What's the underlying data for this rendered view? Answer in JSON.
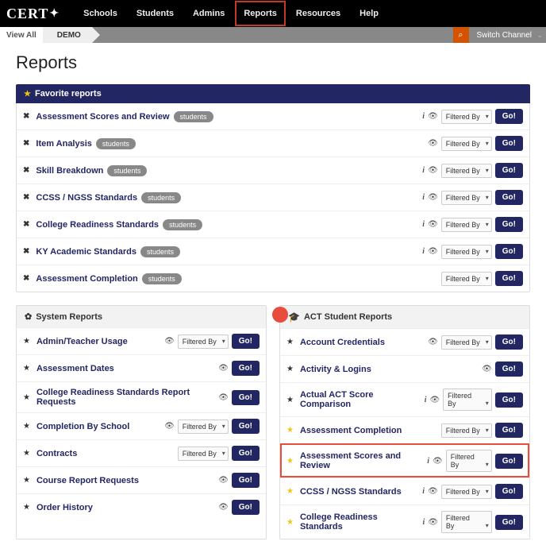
{
  "brand": "CERT",
  "nav": {
    "items": [
      "Schools",
      "Students",
      "Admins",
      "Reports",
      "Resources",
      "Help"
    ],
    "active": "Reports"
  },
  "subbar": {
    "viewAll": "View All",
    "demo": "DEMO",
    "switch": "Switch Channel"
  },
  "page": {
    "title": "Reports"
  },
  "labels": {
    "filteredBy": "Filtered By",
    "go": "Go!",
    "favoriteReports": "Favorite reports"
  },
  "favorites": [
    {
      "name": "Assessment Scores and Review",
      "badge": "students",
      "info": true,
      "eye": true
    },
    {
      "name": "Item Analysis",
      "badge": "students",
      "info": false,
      "eye": true
    },
    {
      "name": "Skill Breakdown",
      "badge": "students",
      "info": true,
      "eye": true
    },
    {
      "name": "CCSS / NGSS Standards",
      "badge": "students",
      "info": true,
      "eye": true
    },
    {
      "name": "College Readiness Standards",
      "badge": "students",
      "info": true,
      "eye": true
    },
    {
      "name": "KY Academic Standards",
      "badge": "students",
      "info": true,
      "eye": true
    },
    {
      "name": "Assessment Completion",
      "badge": "students",
      "info": false,
      "eye": false
    }
  ],
  "systemReports": {
    "title": "System Reports",
    "items": [
      {
        "name": "Admin/Teacher Usage",
        "eye": true,
        "filter": true
      },
      {
        "name": "Assessment Dates",
        "eye": true,
        "filter": false
      },
      {
        "name": "College Readiness Standards Report Requests",
        "eye": true,
        "filter": false
      },
      {
        "name": "Completion By School",
        "eye": true,
        "filter": true
      },
      {
        "name": "Contracts",
        "eye": false,
        "filter": true
      },
      {
        "name": "Course Report Requests",
        "eye": true,
        "filter": false
      },
      {
        "name": "Order History",
        "eye": true,
        "filter": false
      }
    ]
  },
  "actReports": {
    "title": "ACT Student Reports",
    "items": [
      {
        "name": "Account Credentials",
        "fav": false,
        "eye": true,
        "info": false,
        "filter": true,
        "hl": false
      },
      {
        "name": "Activity & Logins",
        "fav": false,
        "eye": true,
        "info": false,
        "filter": false,
        "hl": false
      },
      {
        "name": "Actual ACT Score Comparison",
        "fav": false,
        "eye": true,
        "info": true,
        "filter": true,
        "hl": false
      },
      {
        "name": "Assessment Completion",
        "fav": true,
        "eye": false,
        "info": false,
        "filter": true,
        "hl": false
      },
      {
        "name": "Assessment Scores and Review",
        "fav": true,
        "eye": true,
        "info": true,
        "filter": true,
        "hl": true
      },
      {
        "name": "CCSS / NGSS Standards",
        "fav": true,
        "eye": true,
        "info": true,
        "filter": true,
        "hl": false
      },
      {
        "name": "College Readiness Standards",
        "fav": true,
        "eye": true,
        "info": true,
        "filter": true,
        "hl": false
      }
    ]
  }
}
